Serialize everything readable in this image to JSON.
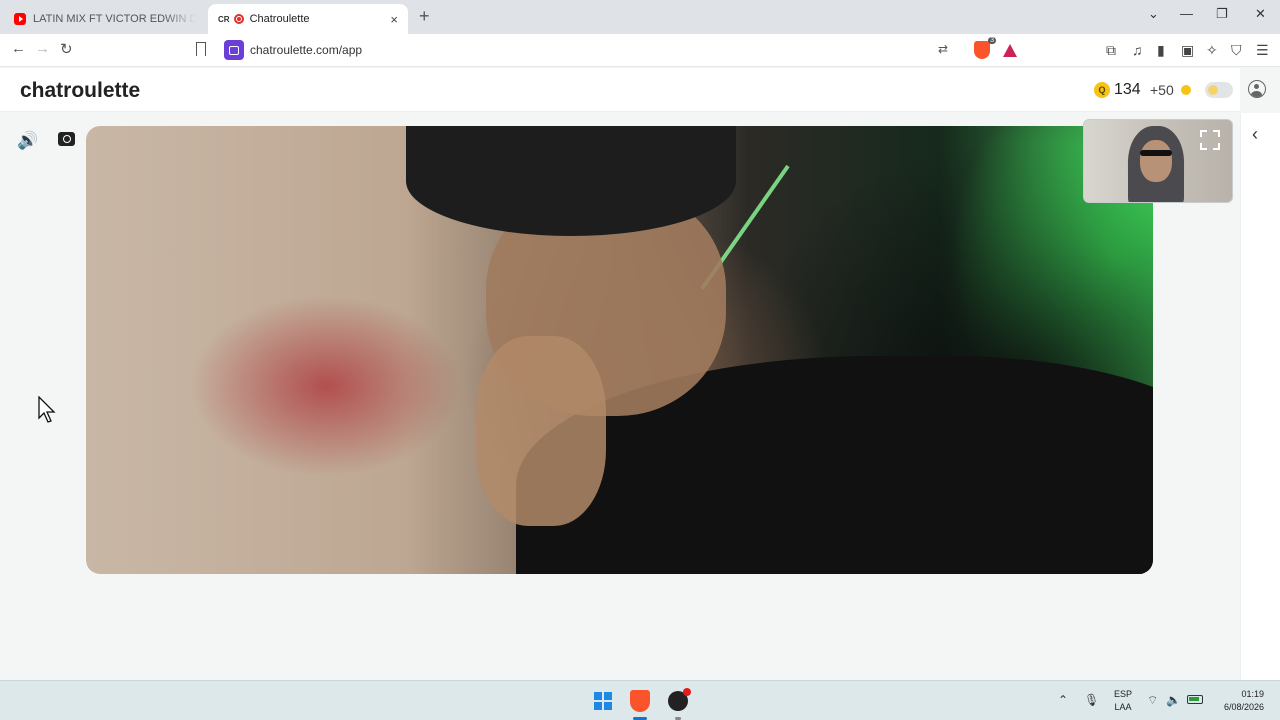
{
  "browser": {
    "tabs": [
      {
        "title": "LATIN MIX FT VICTOR EDWIN DJ (GU",
        "active": false
      },
      {
        "prefix": "CR",
        "title": "Chatroulette",
        "active": true
      }
    ],
    "new_tab": "+",
    "close_tab": "×",
    "address": "chatroulette.com/app",
    "window_controls": {
      "dropdown": "⌄",
      "minimize": "—",
      "maximize": "❐",
      "close": "✕"
    },
    "shield_count": "3"
  },
  "site": {
    "logo": "chatroulette",
    "coin_symbol": "Q",
    "coins": "134",
    "bonus": "+50",
    "accent_color": "#f7c315"
  },
  "icons": {
    "back": "←",
    "forward": "→",
    "reload": "↻",
    "volume": "🔊",
    "collapse": "‹",
    "extensions": "⧉",
    "music": "♫",
    "sidebar": "▮",
    "wallet": "▣",
    "leo": "✧",
    "vpn": "⛉",
    "menu": "☰",
    "translate": "⇄"
  },
  "taskbar": {
    "language": "ESP",
    "layout": "LAA",
    "time": "01:19",
    "date": "6/08/2026",
    "tray_up": "⌃",
    "mic": "🎙",
    "wifi": "⌔",
    "speaker": "🔈"
  }
}
